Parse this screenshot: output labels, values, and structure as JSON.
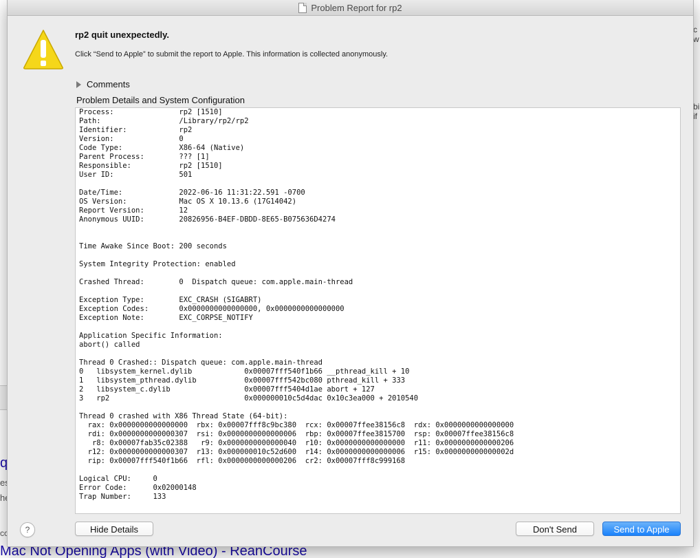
{
  "background": {
    "right_fragments": [
      "c",
      "w",
      "bi",
      "if"
    ],
    "left_fragments": [
      "q",
      "es",
      "he",
      "cc"
    ],
    "bottom_link": "Mac Not Opening Apps (with Video) - ReanCourse"
  },
  "window": {
    "title": "Problem Report for rp2",
    "title_icon": "document-icon"
  },
  "alert": {
    "icon": "warning-icon",
    "icon_color": "#f5d71a",
    "headline": "rp2 quit unexpectedly.",
    "message": "Click “Send to Apple” to submit the report to Apple. This information is collected anonymously."
  },
  "comments": {
    "label": "Comments",
    "expanded": false
  },
  "details": {
    "heading": "Problem Details and System Configuration",
    "lines": [
      "Process:               rp2 [1510]",
      "Path:                  /Library/rp2/rp2",
      "Identifier:            rp2",
      "Version:               0",
      "Code Type:             X86-64 (Native)",
      "Parent Process:        ??? [1]",
      "Responsible:           rp2 [1510]",
      "User ID:               501",
      "",
      "Date/Time:             2022-06-16 11:31:22.591 -0700",
      "OS Version:            Mac OS X 10.13.6 (17G14042)",
      "Report Version:        12",
      "Anonymous UUID:        20826956-B4EF-DBDD-8E65-B075636D4274",
      "",
      "",
      "Time Awake Since Boot: 200 seconds",
      "",
      "System Integrity Protection: enabled",
      "",
      "Crashed Thread:        0  Dispatch queue: com.apple.main-thread",
      "",
      "Exception Type:        EXC_CRASH (SIGABRT)",
      "Exception Codes:       0x0000000000000000, 0x0000000000000000",
      "Exception Note:        EXC_CORPSE_NOTIFY",
      "",
      "Application Specific Information:",
      "abort() called",
      "",
      "Thread 0 Crashed:: Dispatch queue: com.apple.main-thread",
      "0   libsystem_kernel.dylib            0x00007fff540f1b66 __pthread_kill + 10",
      "1   libsystem_pthread.dylib           0x00007fff542bc080 pthread_kill + 333",
      "2   libsystem_c.dylib                 0x00007fff5404d1ae abort + 127",
      "3   rp2                               0x000000010c5d4dac 0x10c3ea000 + 2010540",
      "",
      "Thread 0 crashed with X86 Thread State (64-bit):",
      "  rax: 0x0000000000000000  rbx: 0x00007fff8c9bc380  rcx: 0x00007ffee38156c8  rdx: 0x0000000000000000",
      "  rdi: 0x0000000000000307  rsi: 0x0000000000000006  rbp: 0x00007ffee3815700  rsp: 0x00007ffee38156c8",
      "   r8: 0x00007fab35c02388   r9: 0x0000000000000040  r10: 0x0000000000000000  r11: 0x0000000000000206",
      "  r12: 0x0000000000000307  r13: 0x000000010c52d600  r14: 0x0000000000000006  r15: 0x000000000000002d",
      "  rip: 0x00007fff540f1b66  rfl: 0x0000000000000206  cr2: 0x00007fff8c999168",
      "",
      "Logical CPU:     0",
      "Error Code:      0x02000148",
      "Trap Number:     133"
    ]
  },
  "buttons": {
    "help": "?",
    "hide_details": "Hide Details",
    "dont_send": "Don't Send",
    "send": "Send to Apple",
    "send_color": "#1a82fb"
  }
}
